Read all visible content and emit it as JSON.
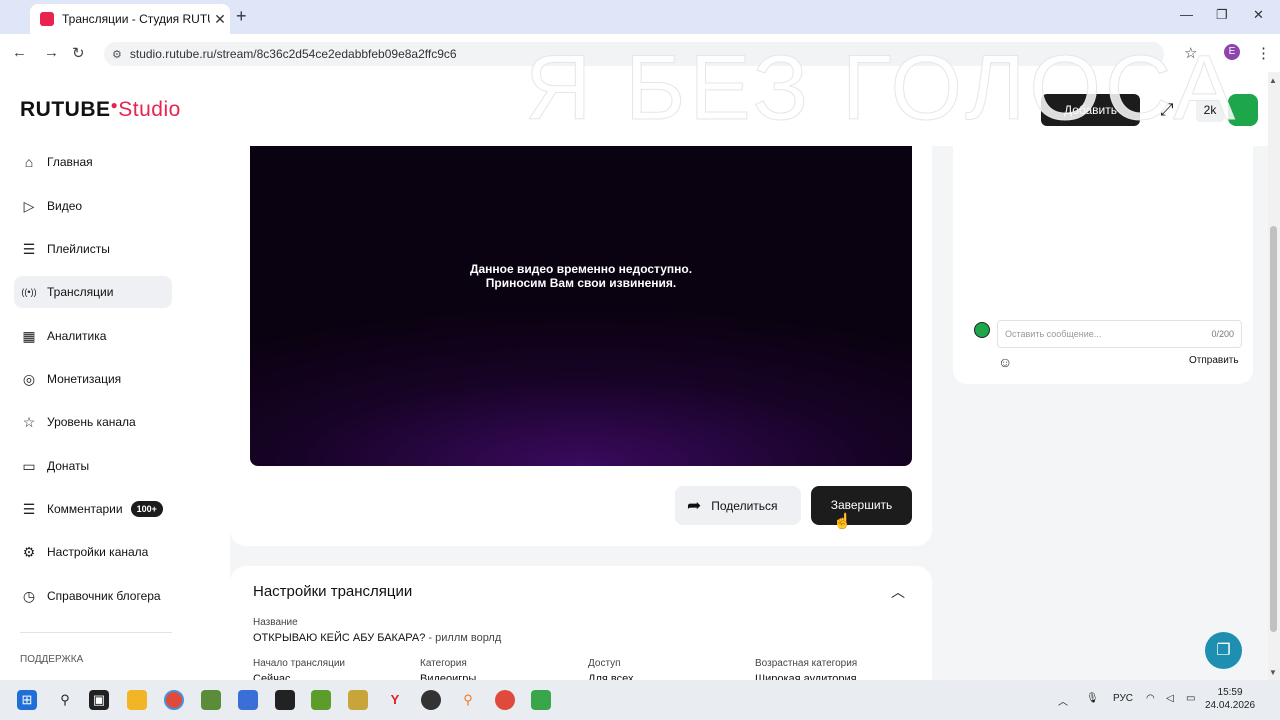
{
  "browser": {
    "tab_title": "Трансляции - Студия RUTUBE",
    "tab_close": "✕",
    "new_tab": "+",
    "url": "studio.rutube.ru/stream/8c36c2d54ce2edabbfeb09e8a2ffc9c6",
    "profile_initial": "E",
    "win_min": "—",
    "win_max": "❐",
    "win_close": "✕"
  },
  "header": {
    "logo_main": "RUTUBE",
    "logo_studio": "Studio",
    "add_label": "Добавить",
    "viewers": "2k",
    "overlay_text": "Я БЕЗ ГОЛОСА"
  },
  "sidebar": {
    "items": [
      {
        "label": "Главная",
        "icon": "home-icon",
        "glyph": "⌂"
      },
      {
        "label": "Видео",
        "icon": "video-icon",
        "glyph": "▷"
      },
      {
        "label": "Плейлисты",
        "icon": "playlist-icon",
        "glyph": "☰"
      },
      {
        "label": "Трансляции",
        "icon": "broadcast-icon",
        "glyph": "((•))"
      },
      {
        "label": "Аналитика",
        "icon": "analytics-icon",
        "glyph": "▦"
      },
      {
        "label": "Монетизация",
        "icon": "monetization-icon",
        "glyph": "◎"
      },
      {
        "label": "Уровень канала",
        "icon": "level-icon",
        "glyph": "☆"
      },
      {
        "label": "Донаты",
        "icon": "donations-icon",
        "glyph": "▭"
      },
      {
        "label": "Комментарии",
        "icon": "comments-icon",
        "glyph": "☰"
      },
      {
        "label": "Настройки канала",
        "icon": "settings-icon",
        "glyph": "⚙"
      },
      {
        "label": "Справочник блогера",
        "icon": "guide-icon",
        "glyph": "◷"
      }
    ],
    "comments_badge": "100+",
    "support_label": "ПОДДЕРЖКА"
  },
  "player": {
    "message_line1": "Данное видео временно недоступно.",
    "message_line2": "Приносим Вам свои извинения."
  },
  "actions": {
    "share_label": "Поделиться",
    "end_label": "Завершить"
  },
  "settings": {
    "title": "Настройки трансляции",
    "name_label": "Название",
    "name_value": "ОТКРЫВАЮ КЕЙС АБУ БАКАРА?",
    "name_suffix": " - риллм ворлд",
    "start_label": "Начало трансляции",
    "start_value": "Сейчас",
    "category_label": "Категория",
    "category_value": "Видеоигры",
    "access_label": "Доступ",
    "access_value": "Для всех",
    "age_label": "Возрастная категория",
    "age_value": "Широкая аудитория"
  },
  "chat": {
    "placeholder": "Оставить сообщение...",
    "counter": "0/200",
    "send_label": "Отправить"
  },
  "taskbar": {
    "lang": "РУС",
    "time": "15:59",
    "date": "24.04.2026"
  },
  "colors": {
    "accent": "#e8234f",
    "dark_button": "#1c1c1c",
    "avatar_green": "#1ea64a",
    "fab": "#1e8fb0"
  }
}
